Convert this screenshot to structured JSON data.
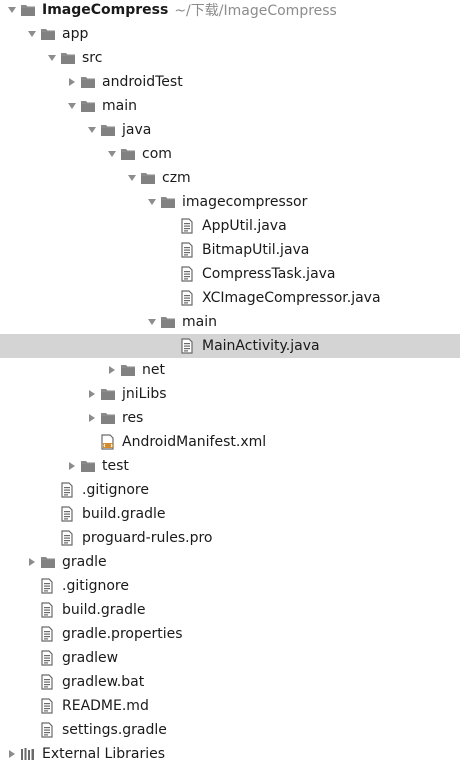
{
  "rows": [
    {
      "label": "ImageCompress",
      "path": "~/下载/ImageCompress",
      "indent": 0,
      "arrow": "down",
      "icon": "folder",
      "bold": true
    },
    {
      "label": "app",
      "indent": 1,
      "arrow": "down",
      "icon": "folder"
    },
    {
      "label": "src",
      "indent": 2,
      "arrow": "down",
      "icon": "folder"
    },
    {
      "label": "androidTest",
      "indent": 3,
      "arrow": "right",
      "icon": "folder"
    },
    {
      "label": "main",
      "indent": 3,
      "arrow": "down",
      "icon": "folder"
    },
    {
      "label": "java",
      "indent": 4,
      "arrow": "down",
      "icon": "folder"
    },
    {
      "label": "com",
      "indent": 5,
      "arrow": "down",
      "icon": "folder"
    },
    {
      "label": "czm",
      "indent": 6,
      "arrow": "down",
      "icon": "folder"
    },
    {
      "label": "imagecompressor",
      "indent": 7,
      "arrow": "down",
      "icon": "folder"
    },
    {
      "label": "AppUtil.java",
      "indent": 8,
      "arrow": "none",
      "icon": "file"
    },
    {
      "label": "BitmapUtil.java",
      "indent": 8,
      "arrow": "none",
      "icon": "file"
    },
    {
      "label": "CompressTask.java",
      "indent": 8,
      "arrow": "none",
      "icon": "file"
    },
    {
      "label": "XCImageCompressor.java",
      "indent": 8,
      "arrow": "none",
      "icon": "file"
    },
    {
      "label": "main",
      "indent": 7,
      "arrow": "down",
      "icon": "folder"
    },
    {
      "label": "MainActivity.java",
      "indent": 8,
      "arrow": "none",
      "icon": "file",
      "selected": true
    },
    {
      "label": "net",
      "indent": 5,
      "arrow": "right",
      "icon": "folder"
    },
    {
      "label": "jniLibs",
      "indent": 4,
      "arrow": "right",
      "icon": "folder"
    },
    {
      "label": "res",
      "indent": 4,
      "arrow": "right",
      "icon": "folder"
    },
    {
      "label": "AndroidManifest.xml",
      "indent": 4,
      "arrow": "none",
      "icon": "xml"
    },
    {
      "label": "test",
      "indent": 3,
      "arrow": "right",
      "icon": "folder"
    },
    {
      "label": ".gitignore",
      "indent": 2,
      "arrow": "none",
      "icon": "file"
    },
    {
      "label": "build.gradle",
      "indent": 2,
      "arrow": "none",
      "icon": "file"
    },
    {
      "label": "proguard-rules.pro",
      "indent": 2,
      "arrow": "none",
      "icon": "file"
    },
    {
      "label": "gradle",
      "indent": 1,
      "arrow": "right",
      "icon": "folder"
    },
    {
      "label": ".gitignore",
      "indent": 1,
      "arrow": "none",
      "icon": "file"
    },
    {
      "label": "build.gradle",
      "indent": 1,
      "arrow": "none",
      "icon": "file"
    },
    {
      "label": "gradle.properties",
      "indent": 1,
      "arrow": "none",
      "icon": "file"
    },
    {
      "label": "gradlew",
      "indent": 1,
      "arrow": "none",
      "icon": "file"
    },
    {
      "label": "gradlew.bat",
      "indent": 1,
      "arrow": "none",
      "icon": "file"
    },
    {
      "label": "README.md",
      "indent": 1,
      "arrow": "none",
      "icon": "file"
    },
    {
      "label": "settings.gradle",
      "indent": 1,
      "arrow": "none",
      "icon": "file"
    },
    {
      "label": "External Libraries",
      "indent": 0,
      "arrow": "right",
      "icon": "libraries"
    }
  ],
  "colors": {
    "folder": "#8a8a8a",
    "folder_dark": "#6f6f6f",
    "file": "#6a6a6a",
    "arrow": "#8c8c8c",
    "selected_bg": "#d4d4d4",
    "xml_accent": "#d38a2a"
  }
}
